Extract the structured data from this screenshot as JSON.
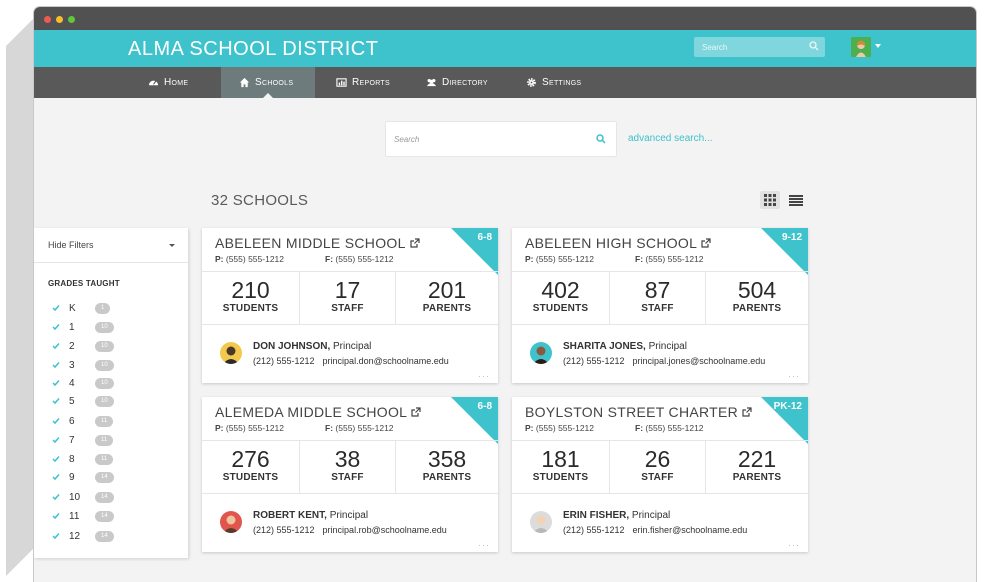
{
  "app": {
    "title": "ALMA SCHOOL DISTRICT",
    "top_search_placeholder": "Search"
  },
  "nav": {
    "items": [
      {
        "label": "Home",
        "icon": "dashboard-icon"
      },
      {
        "label": "Schools",
        "icon": "home-icon",
        "active": true
      },
      {
        "label": "Reports",
        "icon": "chart-icon"
      },
      {
        "label": "Directory",
        "icon": "users-icon"
      },
      {
        "label": "Settings",
        "icon": "gear-icon"
      }
    ]
  },
  "search": {
    "placeholder": "Search",
    "advanced_label": "advanced search..."
  },
  "results": {
    "count_label": "32 SCHOOLS"
  },
  "filters": {
    "hide_label": "Hide Filters",
    "grades_title": "GRADES TAUGHT",
    "grades": [
      {
        "name": "K",
        "count": "1"
      },
      {
        "name": "1",
        "count": "10"
      },
      {
        "name": "2",
        "count": "10"
      },
      {
        "name": "3",
        "count": "10"
      },
      {
        "name": "4",
        "count": "10"
      },
      {
        "name": "5",
        "count": "10"
      },
      {
        "name": "6",
        "count": "11"
      },
      {
        "name": "7",
        "count": "11"
      },
      {
        "name": "8",
        "count": "11"
      },
      {
        "name": "9",
        "count": "14"
      },
      {
        "name": "10",
        "count": "14"
      },
      {
        "name": "11",
        "count": "14"
      },
      {
        "name": "12",
        "count": "14"
      }
    ]
  },
  "schools": [
    {
      "name": "ABELEEN MIDDLE SCHOOL",
      "grades": "6-8",
      "phone_label": "P:",
      "phone": "(555) 555-1212",
      "fax_label": "F:",
      "fax": "(555) 555-1212",
      "students": "210",
      "students_label": "STUDENTS",
      "staff": "17",
      "staff_label": "STAFF",
      "parents": "201",
      "parents_label": "PARENTS",
      "principal": "DON JOHNSON,",
      "principal_role": "Principal",
      "principal_phone": "(212) 555-1212",
      "principal_email": "principal.don@schoolname.edu"
    },
    {
      "name": "ABELEEN HIGH SCHOOL",
      "grades": "9-12",
      "phone_label": "P:",
      "phone": "(555) 555-1212",
      "fax_label": "F:",
      "fax": "(555) 555-1212",
      "students": "402",
      "students_label": "STUDENTS",
      "staff": "87",
      "staff_label": "STAFF",
      "parents": "504",
      "parents_label": "PARENTS",
      "principal": "SHARITA JONES,",
      "principal_role": "Principal",
      "principal_phone": "(212) 555-1212",
      "principal_email": "principal.jones@schoolname.edu"
    },
    {
      "name": "ALEMEDA MIDDLE SCHOOL",
      "grades": "6-8",
      "phone_label": "P:",
      "phone": "(555) 555-1212",
      "fax_label": "F:",
      "fax": "(555) 555-1212",
      "students": "276",
      "students_label": "STUDENTS",
      "staff": "38",
      "staff_label": "STAFF",
      "parents": "358",
      "parents_label": "PARENTS",
      "principal": "ROBERT KENT,",
      "principal_role": "Principal",
      "principal_phone": "(212) 555-1212",
      "principal_email": "principal.rob@schoolname.edu"
    },
    {
      "name": "BOYLSTON STREET CHARTER",
      "grades": "PK-12",
      "phone_label": "P:",
      "phone": "(555) 555-1212",
      "fax_label": "F:",
      "fax": "(555) 555-1212",
      "students": "181",
      "students_label": "STUDENTS",
      "staff": "26",
      "staff_label": "STAFF",
      "parents": "221",
      "parents_label": "PARENTS",
      "principal": "ERIN FISHER,",
      "principal_role": "Principal",
      "principal_phone": "(212) 555-1212",
      "principal_email": "erin.fisher@schoolname.edu"
    }
  ],
  "colors": {
    "accent": "#3ec2cc",
    "navbar": "#595959",
    "titlebar": "#515151",
    "background": "#f3f3f3"
  }
}
